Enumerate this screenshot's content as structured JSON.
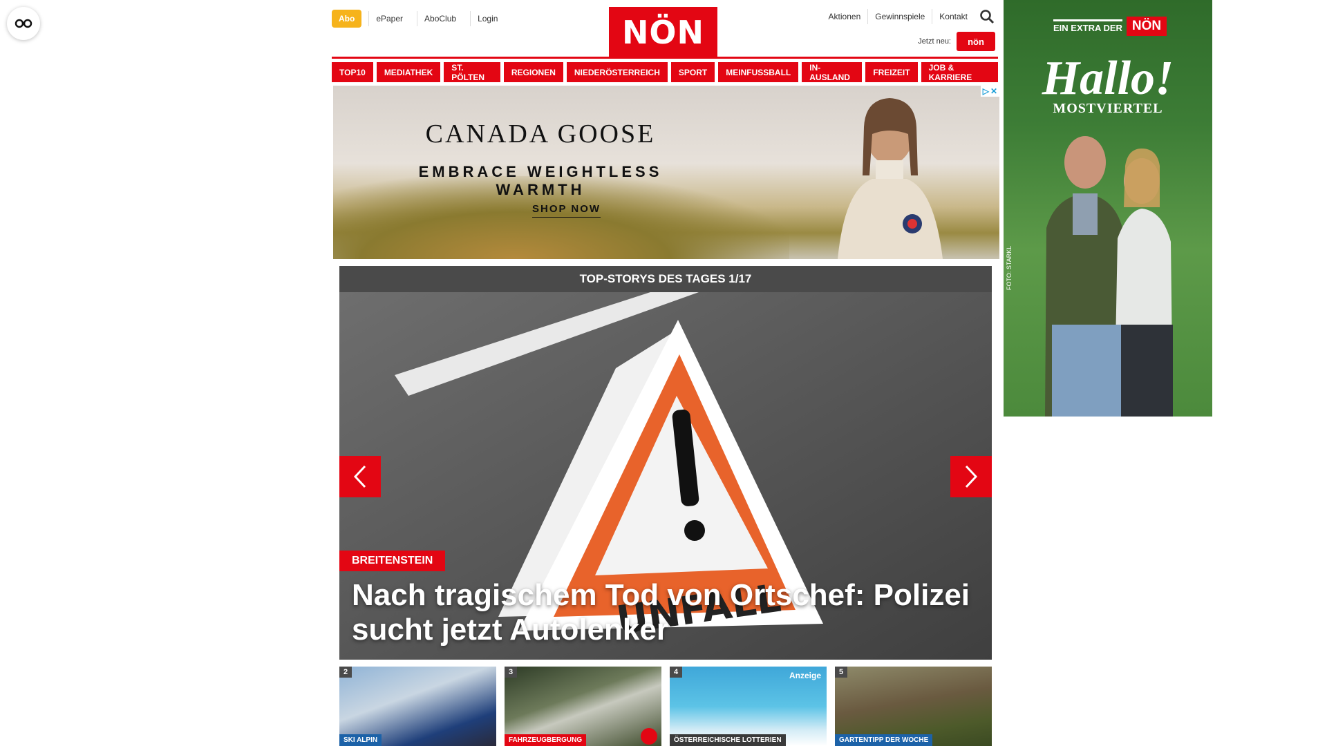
{
  "header": {
    "abo": "Abo",
    "links_left": [
      "ePaper",
      "AboClub",
      "Login"
    ],
    "logo": "NÖN",
    "links_right": [
      "Aktionen",
      "Gewinnspiele",
      "Kontakt"
    ],
    "jetzt_neu": "Jetzt neu:",
    "jetzt_logo": "nön"
  },
  "mainnav": [
    "TOP10",
    "MEDIATHEK",
    "ST. PÖLTEN",
    "REGIONEN",
    "NIEDERÖSTERREICH",
    "SPORT",
    "MEINFUSSBALL",
    "IN-AUSLAND",
    "FREIZEIT",
    "JOB & KARRIERE"
  ],
  "ad": {
    "brand": "CANADA GOOSE",
    "tagline": "EMBRACE WEIGHTLESS WARMTH",
    "cta": "SHOP NOW"
  },
  "carousel": {
    "title": "TOP-STORYS DES TAGES 1/17",
    "category": "BREITENSTEIN",
    "headline": "Nach tragischem Tod von Ortschef: Polizei sucht jetzt Autolenker",
    "sign_text": "UNFALL"
  },
  "thumbs": [
    {
      "num": "2",
      "tag": "SKI ALPIN",
      "color": "#1c62a8"
    },
    {
      "num": "3",
      "tag": "FAHRZEUGBERGUNG",
      "color": "#e30613"
    },
    {
      "num": "4",
      "tag": "ÖSTERREICHISCHE LOTTERIEN",
      "color": "#3a3a3a",
      "badge": "Anzeige"
    },
    {
      "num": "5",
      "tag": "GARTENTIPP DER WOCHE",
      "color": "#1c62a8"
    }
  ],
  "sidead": {
    "extra": "EIN EXTRA DER",
    "logo": "NÖN",
    "hallo": "Hallo!",
    "sub": "MOSTVIERTEL",
    "foto": "FOTO: STARKL"
  },
  "colors": {
    "brand": "#e30613",
    "abo": "#f6b31b"
  }
}
